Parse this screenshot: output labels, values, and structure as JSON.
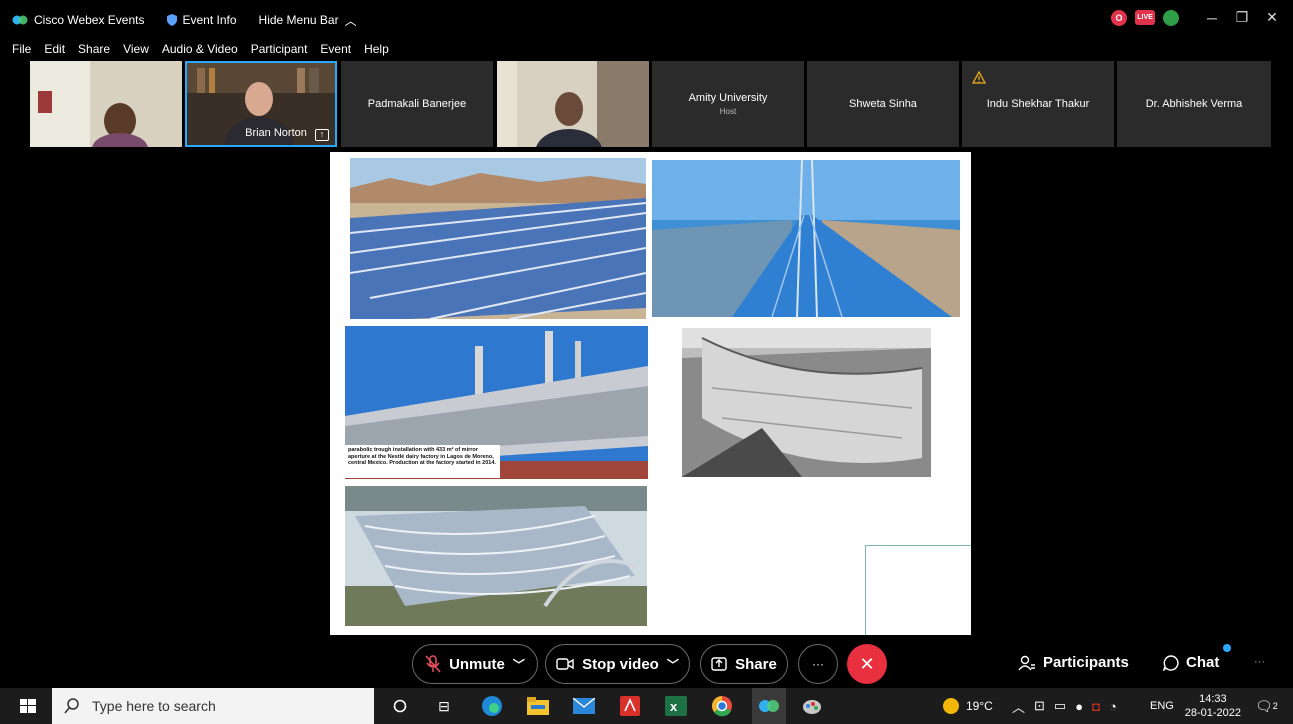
{
  "titlebar": {
    "app_name": "Cisco Webex Events",
    "event_info": "Event Info",
    "hide_menu": "Hide Menu Bar",
    "rec_label": "O",
    "live_label": "LIVE"
  },
  "menu": [
    "File",
    "Edit",
    "Share",
    "View",
    "Audio & Video",
    "Participant",
    "Event",
    "Help"
  ],
  "participants": [
    {
      "name": "",
      "role": ""
    },
    {
      "name": "Brian Norton",
      "role": ""
    },
    {
      "name": "Padmakali Banerjee",
      "role": ""
    },
    {
      "name": "",
      "role": ""
    },
    {
      "name": "Amity University",
      "role": "Host"
    },
    {
      "name": "Shweta Sinha",
      "role": ""
    },
    {
      "name": "Indu Shekhar Thakur",
      "role": ""
    },
    {
      "name": "Dr. Abhishek Verma",
      "role": ""
    }
  ],
  "slide": {
    "caption": "parabolic trough installation with 433 m² of mirror aperture at the Nestlé dairy factory in Lagos de Moreno, central Mexico. Production at the factory started in 2014."
  },
  "controls": {
    "unmute": "Unmute",
    "stop_video": "Stop video",
    "share": "Share",
    "more": "···",
    "participants": "Participants",
    "chat": "Chat",
    "overflow": "···"
  },
  "taskbar": {
    "search_placeholder": "Type here to search",
    "weather": "19°C",
    "language": "ENG",
    "time": "14:33",
    "date": "28-01-2022",
    "notif_count": "2"
  },
  "colors": {
    "accent_blue": "#2aa8ff",
    "end_red": "#e8303f",
    "tile_bg": "#2b2b2b"
  }
}
